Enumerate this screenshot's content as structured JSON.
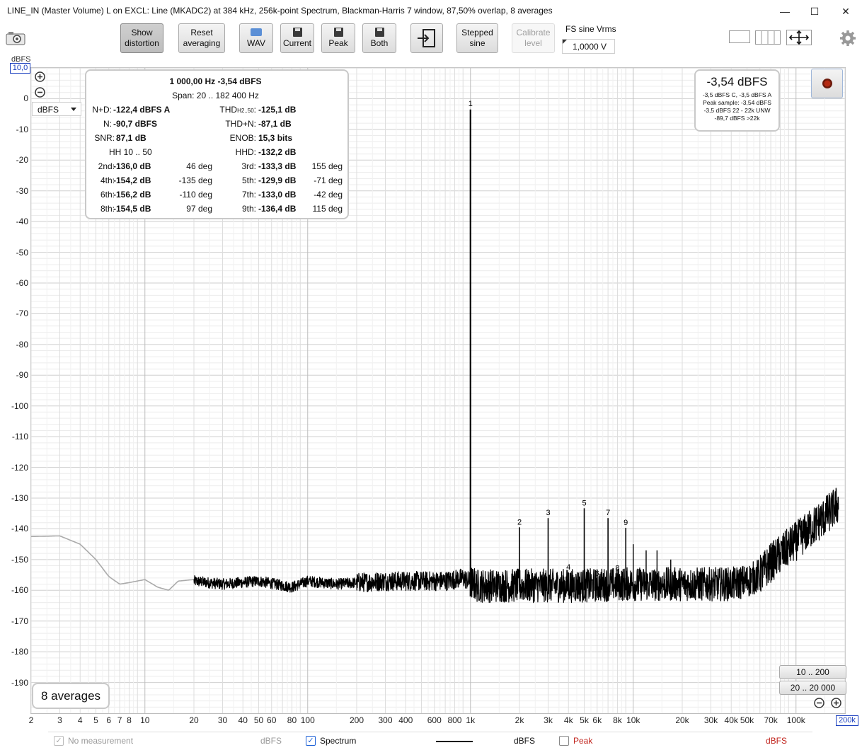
{
  "window": {
    "title": "LINE_IN (Master Volume) L on EXCL: Line (MKADC2) at 384 kHz, 256k-point Spectrum, Blackman-Harris 7 window, 87,50% overlap, 8 averages",
    "minimize": "—",
    "maximize": "☐",
    "close": "✕"
  },
  "toolbar": {
    "show_distortion_1": "Show",
    "show_distortion_2": "distortion",
    "reset_1": "Reset",
    "reset_2": "averaging",
    "wav": "WAV",
    "current": "Current",
    "peak": "Peak",
    "both": "Both",
    "stepped_1": "Stepped",
    "stepped_2": "sine",
    "calibrate_1": "Calibrate",
    "calibrate_2": "level",
    "fs_label": "FS sine Vrms",
    "fs_value": "1,0000 V"
  },
  "plot": {
    "y_unit_top": "dBFS",
    "y_top_box": "10,0",
    "unit_select": "dBFS",
    "x_end_box": "200k",
    "averages": "8 averages",
    "range_btn_1": "10 .. 200",
    "range_btn_2": "20 .. 20 000"
  },
  "stats": {
    "header": "1 000,00 Hz  -3,54 dBFS",
    "span": "Span: 20 .. 182 400 Hz",
    "nd_label": "N+D:",
    "nd_val": "-122,4 dBFS A",
    "thd_label": "THDH2..50:",
    "thd_val": "-125,1 dB",
    "n_label": "N:",
    "n_val": "-90,7 dBFS",
    "thdn_label": "THD+N:",
    "thdn_val": "-87,1 dB",
    "snr_label": "SNR:",
    "snr_val": "87,1 dB",
    "enob_label": "ENOB:",
    "enob_val": "15,3 bits",
    "hh_label": "HH 10 .. 50",
    "hhd_label": "HHD:",
    "hhd_val": "-132,2 dB",
    "h2_label": "2nd:",
    "h2_val": "-136,0 dB",
    "h2_deg": "46 deg",
    "h3_label": "3rd:",
    "h3_val": "-133,3 dB",
    "h3_deg": "155 deg",
    "h4_label": "4th:",
    "h4_val": "-154,2 dB",
    "h4_deg": "-135 deg",
    "h5_label": "5th:",
    "h5_val": "-129,9 dB",
    "h5_deg": "-71 deg",
    "h6_label": "6th:",
    "h6_val": "-156,2 dB",
    "h6_deg": "-110 deg",
    "h7_label": "7th:",
    "h7_val": "-133,0 dB",
    "h7_deg": "-42 deg",
    "h8_label": "8th:",
    "h8_val": "-154,5 dB",
    "h8_deg": "97 deg",
    "h9_label": "9th:",
    "h9_val": "-136,4 dB",
    "h9_deg": "115 deg"
  },
  "level": {
    "main": "-3,54 dBFS",
    "l1": "-3,5 dBFS C, -3,5 dBFS A",
    "l2": "Peak sample: -3,54 dBFS",
    "l3": "-3,5 dBFS 22 - 22k UNW",
    "l4": "-89,7 dBFS >22k"
  },
  "legend": {
    "no_measurement": "No measurement",
    "nm_unit": "dBFS",
    "spectrum": "Spectrum",
    "spectrum_unit": "dBFS",
    "peak": "Peak",
    "peak_unit": "dBFS"
  },
  "chart_data": {
    "type": "line",
    "xscale": "log",
    "xlim": [
      2,
      200000
    ],
    "ylim": [
      -200,
      10
    ],
    "y_ticks": [
      "0",
      "-10",
      "-20",
      "-30",
      "-40",
      "-50",
      "-60",
      "-70",
      "-80",
      "-90",
      "-100",
      "-110",
      "-120",
      "-130",
      "-140",
      "-150",
      "-160",
      "-170",
      "-180",
      "-190"
    ],
    "y_tick_values": [
      0,
      -10,
      -20,
      -30,
      -40,
      -50,
      -60,
      -70,
      -80,
      -90,
      -100,
      -110,
      -120,
      -130,
      -140,
      -150,
      -160,
      -170,
      -180,
      -190
    ],
    "x_ticks": [
      "2",
      "3",
      "4",
      "5",
      "6",
      "7",
      "8",
      "10",
      "20",
      "30",
      "40",
      "50",
      "60",
      "80",
      "100",
      "200",
      "300",
      "400",
      "600",
      "800",
      "1k",
      "2k",
      "3k",
      "4k",
      "5k",
      "6k",
      "8k",
      "10k",
      "20k",
      "30k",
      "40k",
      "50k",
      "70k",
      "100k"
    ],
    "x_tick_values": [
      2,
      3,
      4,
      5,
      6,
      7,
      8,
      10,
      20,
      30,
      40,
      50,
      60,
      80,
      100,
      200,
      300,
      400,
      600,
      800,
      1000,
      2000,
      3000,
      4000,
      5000,
      6000,
      8000,
      10000,
      20000,
      30000,
      40000,
      50000,
      70000,
      100000
    ],
    "fundamental": {
      "x": 1000,
      "y": -3.54,
      "label": "1"
    },
    "harmonics": [
      {
        "label": "2",
        "x": 2000,
        "y": -139.5
      },
      {
        "label": "3",
        "x": 3000,
        "y": -136.5
      },
      {
        "label": "4",
        "x": 4000,
        "y": -154.2
      },
      {
        "label": "5",
        "x": 5000,
        "y": -133.3
      },
      {
        "label": "6",
        "x": 6000,
        "y": -156.2
      },
      {
        "label": "7",
        "x": 7000,
        "y": -136.5
      },
      {
        "label": "8",
        "x": 8000,
        "y": -154.5
      },
      {
        "label": "9",
        "x": 9000,
        "y": -139.7
      }
    ],
    "extra_spurs": [
      {
        "x": 10000,
        "y": -145
      },
      {
        "x": 12000,
        "y": -147
      },
      {
        "x": 14000,
        "y": -147
      },
      {
        "x": 17000,
        "y": -150
      }
    ],
    "series": [
      {
        "color": "#aaaaaa",
        "x": [
          2,
          3,
          4,
          5,
          6,
          7,
          8,
          10,
          12,
          14,
          16,
          20
        ],
        "y": [
          -142.5,
          -142.3,
          -145,
          -150,
          -155.5,
          -158,
          -157.5,
          -156.5,
          -159,
          -160,
          -157,
          -156.5
        ]
      },
      {
        "color": "#000000",
        "x": [
          20,
          30,
          50,
          80,
          100,
          150,
          200,
          300,
          500,
          700,
          900,
          1100,
          1500,
          2000,
          3000,
          5000,
          8000,
          10000,
          20000,
          30000,
          40000,
          50000,
          60000,
          70000,
          100000,
          150000,
          182400
        ],
        "y": [
          -157,
          -158,
          -157,
          -159,
          -157,
          -158,
          -157.5,
          -157,
          -157,
          -157,
          -156,
          -158.5,
          -158.5,
          -158.5,
          -158.5,
          -158.5,
          -158,
          -158,
          -158,
          -158,
          -158,
          -157,
          -155,
          -151,
          -144,
          -136,
          -132
        ]
      }
    ]
  }
}
